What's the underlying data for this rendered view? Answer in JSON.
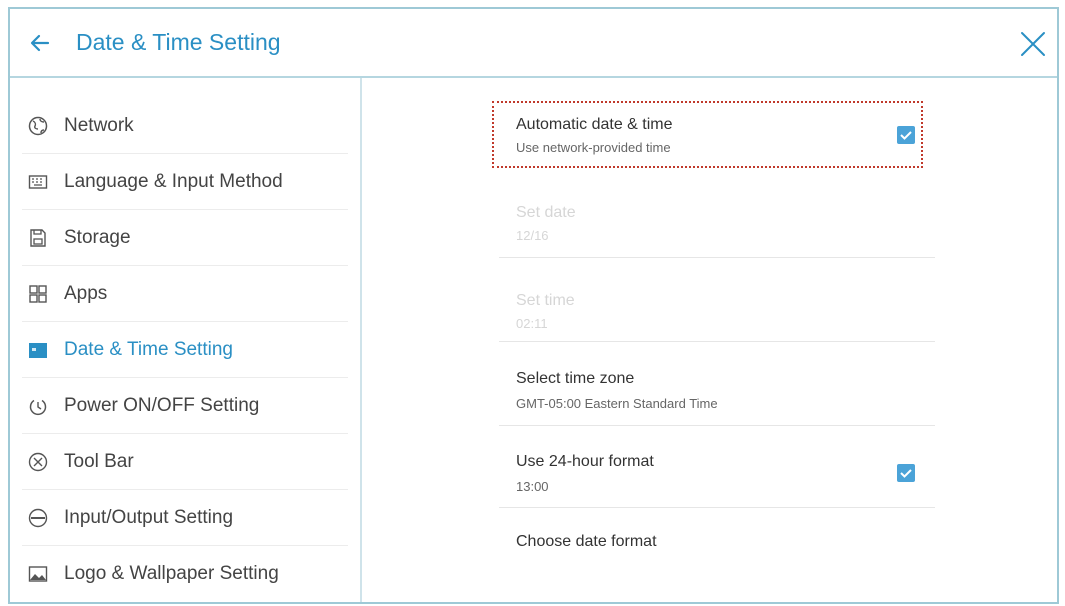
{
  "header": {
    "title": "Date & Time Setting"
  },
  "sidebar": {
    "items": [
      {
        "label": "Network",
        "icon": "globe-icon",
        "active": false
      },
      {
        "label": "Language & Input Method",
        "icon": "keyboard-icon",
        "active": false
      },
      {
        "label": "Storage",
        "icon": "storage-icon",
        "active": false
      },
      {
        "label": "Apps",
        "icon": "apps-icon",
        "active": false
      },
      {
        "label": "Date & Time Setting",
        "icon": "calendar-icon",
        "active": true
      },
      {
        "label": "Power ON/OFF Setting",
        "icon": "power-icon",
        "active": false
      },
      {
        "label": "Tool Bar",
        "icon": "tools-icon",
        "active": false
      },
      {
        "label": "Input/Output Setting",
        "icon": "input-output-icon",
        "active": false
      },
      {
        "label": "Logo & Wallpaper Setting",
        "icon": "image-icon",
        "active": false
      }
    ]
  },
  "settings": {
    "automatic": {
      "title": "Automatic date & time",
      "subtitle": "Use network-provided time",
      "checked": true
    },
    "set_date": {
      "title": "Set date",
      "subtitle": "12/16",
      "enabled": false
    },
    "set_time": {
      "title": "Set time",
      "subtitle": "02:11",
      "enabled": false
    },
    "time_zone": {
      "title": "Select time zone",
      "subtitle": "GMT-05:00 Eastern Standard Time"
    },
    "hour_format": {
      "title": "Use 24-hour format",
      "subtitle": "13:00",
      "checked": true
    },
    "date_format": {
      "title": "Choose date format"
    }
  },
  "colors": {
    "accent": "#2a8fc4",
    "checkbox": "#4ba3d8",
    "focus": "#c0392b"
  }
}
